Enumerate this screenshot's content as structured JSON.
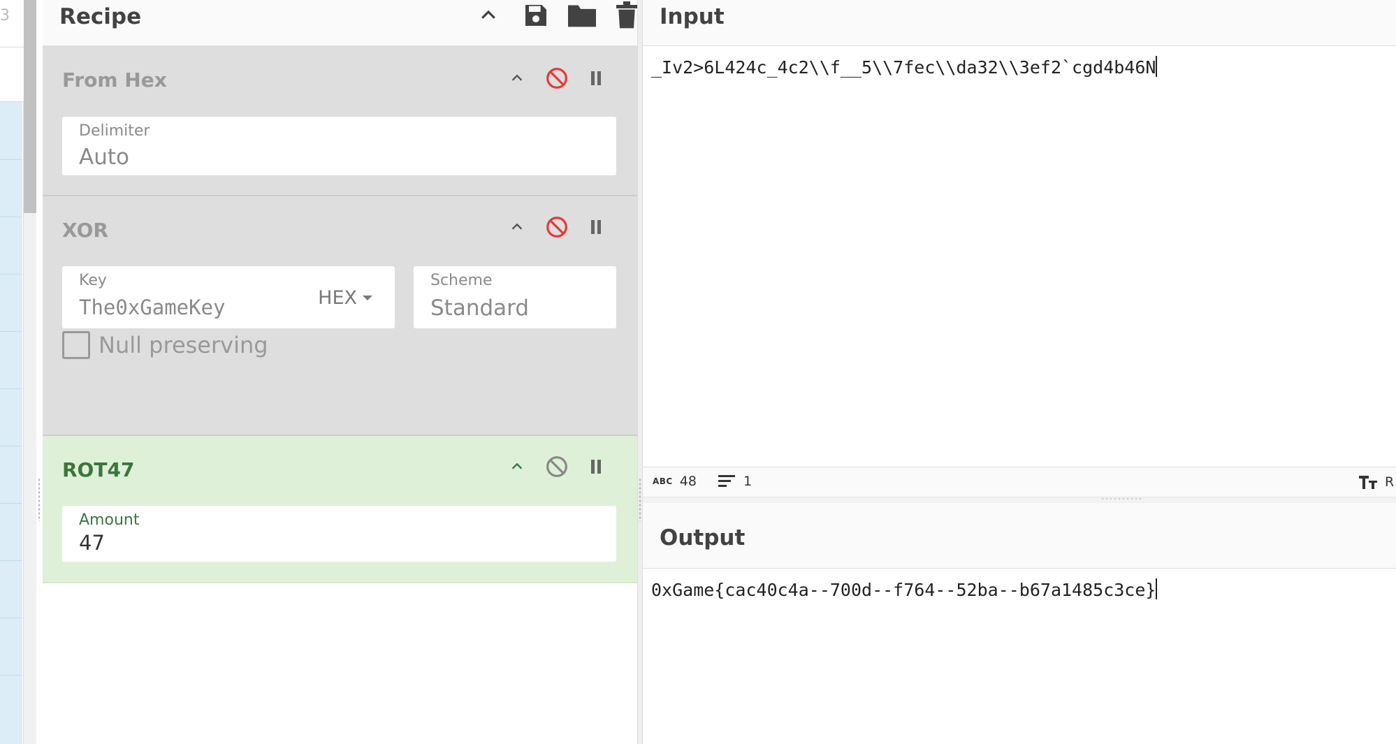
{
  "ops_strip": {
    "top_label": "3"
  },
  "recipe": {
    "title": "Recipe",
    "operations": [
      {
        "name": "From Hex",
        "state": "disabled",
        "fields": [
          {
            "label": "Delimiter",
            "value": "Auto"
          }
        ]
      },
      {
        "name": "XOR",
        "state": "disabled",
        "fields": [
          {
            "label": "Key",
            "value": "The0xGameKey",
            "format": "HEX"
          },
          {
            "label": "Scheme",
            "value": "Standard"
          }
        ],
        "checkbox": {
          "label": "Null preserving",
          "checked": false
        }
      },
      {
        "name": "ROT47",
        "state": "active",
        "fields": [
          {
            "label": "Amount",
            "value": "47"
          }
        ]
      }
    ]
  },
  "input": {
    "title": "Input",
    "text": "_Iv2>6L424c_4c2\\\\f__5\\\\7fec\\\\da32\\\\3ef2`cgd4b46N",
    "length": "48",
    "lines": "1",
    "font_toggle": "R"
  },
  "output": {
    "title": "Output",
    "text": "0xGame{cac40c4a--700d--f764--52ba--b67a1485c3ce}"
  },
  "colors": {
    "disabled_bg": "#dedede",
    "active_bg": "#dff0d8",
    "active_text": "#3c763d",
    "disable_icon_red": "#e53935",
    "icon_dark": "#424242"
  }
}
